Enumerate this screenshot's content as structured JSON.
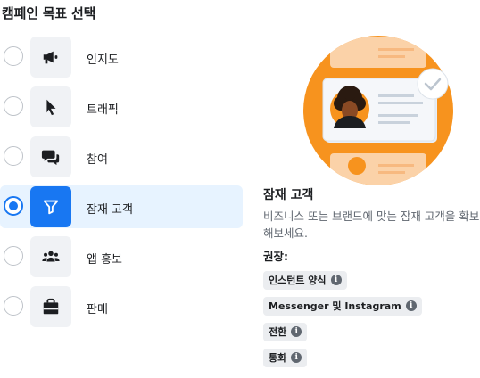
{
  "header": {
    "title": "캠페인 목표 선택"
  },
  "objectives": [
    {
      "label": "인지도",
      "icon": "megaphone-icon",
      "selected": false
    },
    {
      "label": "트래픽",
      "icon": "cursor-icon",
      "selected": false
    },
    {
      "label": "참여",
      "icon": "chat-bubbles-icon",
      "selected": false
    },
    {
      "label": "잠재 고객",
      "icon": "funnel-icon",
      "selected": true
    },
    {
      "label": "앱 홍보",
      "icon": "people-icon",
      "selected": false
    },
    {
      "label": "판매",
      "icon": "shopping-bag-icon",
      "selected": false
    }
  ],
  "detail": {
    "title": "잠재 고객",
    "description": "비즈니스 또는 브랜드에 맞는 잠재 고객을 확보해보세요.",
    "recommended_label": "권장:",
    "recommendations": [
      "인스턴트 양식",
      "Messenger 및 Instagram",
      "전환",
      "통화"
    ],
    "info_glyph": "i"
  },
  "colors": {
    "accent": "#1877f2",
    "selected_bg": "#e7f3ff",
    "illustration_orange": "#f7931e"
  }
}
